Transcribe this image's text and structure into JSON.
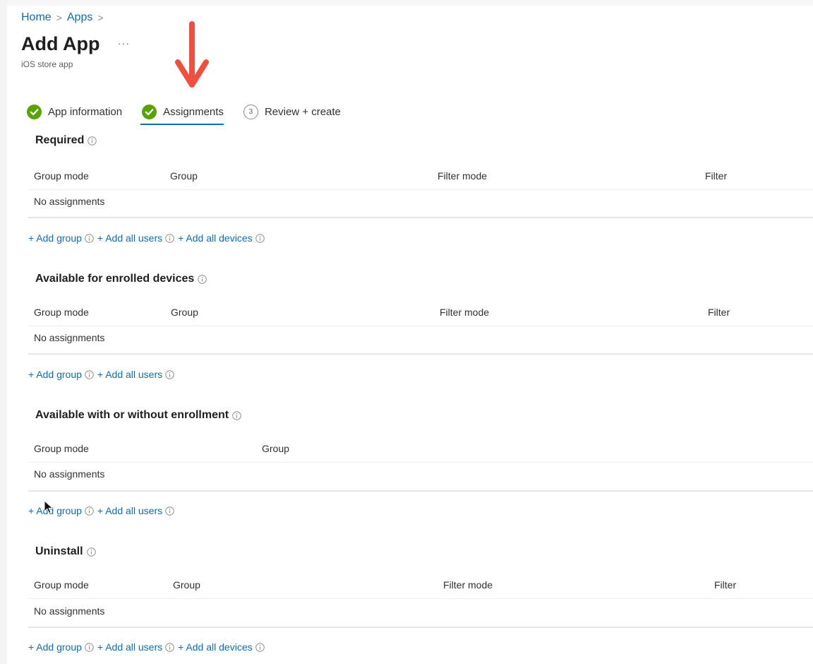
{
  "breadcrumb": {
    "items": [
      "Home",
      "Apps"
    ]
  },
  "page": {
    "title": "Add App",
    "more_label": "···",
    "subtitle": "iOS store app"
  },
  "wizard": {
    "steps": [
      {
        "label": "App information",
        "state": "completed"
      },
      {
        "label": "Assignments",
        "state": "completed",
        "active": true
      },
      {
        "label": "Review + create",
        "number": "3",
        "state": "pending"
      }
    ]
  },
  "sections": [
    {
      "title": "Required",
      "columns": [
        "Group mode",
        "Group",
        "Filter mode",
        "Filter"
      ],
      "empty_text": "No assignments",
      "links": [
        "+ Add group",
        "+ Add all users",
        "+ Add all devices"
      ]
    },
    {
      "title": "Available for enrolled devices",
      "columns": [
        "Group mode",
        "Group",
        "Filter mode",
        "Filter"
      ],
      "empty_text": "No assignments",
      "links": [
        "+ Add group",
        "+ Add all users"
      ]
    },
    {
      "title": "Available with or without enrollment",
      "columns": [
        "Group mode",
        "Group"
      ],
      "empty_text": "No assignments",
      "links": [
        "+ Add group",
        "+ Add all users"
      ]
    },
    {
      "title": "Uninstall",
      "columns": [
        "Group mode",
        "Group",
        "Filter mode",
        "Filter"
      ],
      "empty_text": "No assignments",
      "links": [
        "+ Add group",
        "+ Add all users",
        "+ Add all devices"
      ]
    }
  ],
  "colors": {
    "accent": "#0f6cbd",
    "success": "#57a300",
    "annotation_arrow": "#f04e3e"
  },
  "icons": {
    "completed_step": "check-circle-icon",
    "info": "info-icon",
    "annotation": "red-down-arrow-icon",
    "pointer": "mouse-cursor-icon"
  }
}
